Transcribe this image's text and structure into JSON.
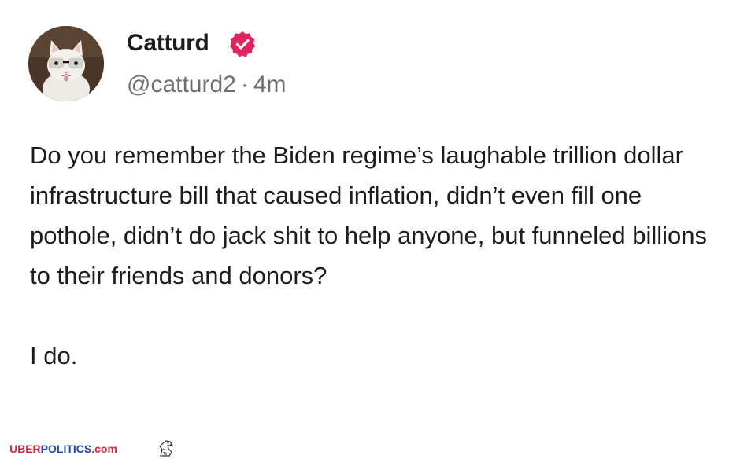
{
  "author": {
    "display_name": "Catturd",
    "handle": "@catturd2",
    "separator": "·",
    "timestamp": "4m",
    "avatar_icon": "cat-with-glasses-avatar",
    "verified_icon": "verified-badge-icon"
  },
  "post": {
    "paragraph_1": "Do you remember the Biden regime’s laughable trillion dollar infrastructure bill that caused inflation, didn’t even fill one pothole, didn’t do jack shit to help anyone, but funneled billions to their friends and donors?",
    "paragraph_2": "I do."
  },
  "watermark": {
    "part_uber": "UBER",
    "part_politics": "POLITICS",
    "part_com": ".com",
    "logo_icon": "eagle-icon"
  },
  "colors": {
    "text": "#1c1c1e",
    "muted": "#6e6e73",
    "verified": "#e0245e",
    "watermark_red": "#d7263d",
    "watermark_blue": "#1f4aa8"
  }
}
